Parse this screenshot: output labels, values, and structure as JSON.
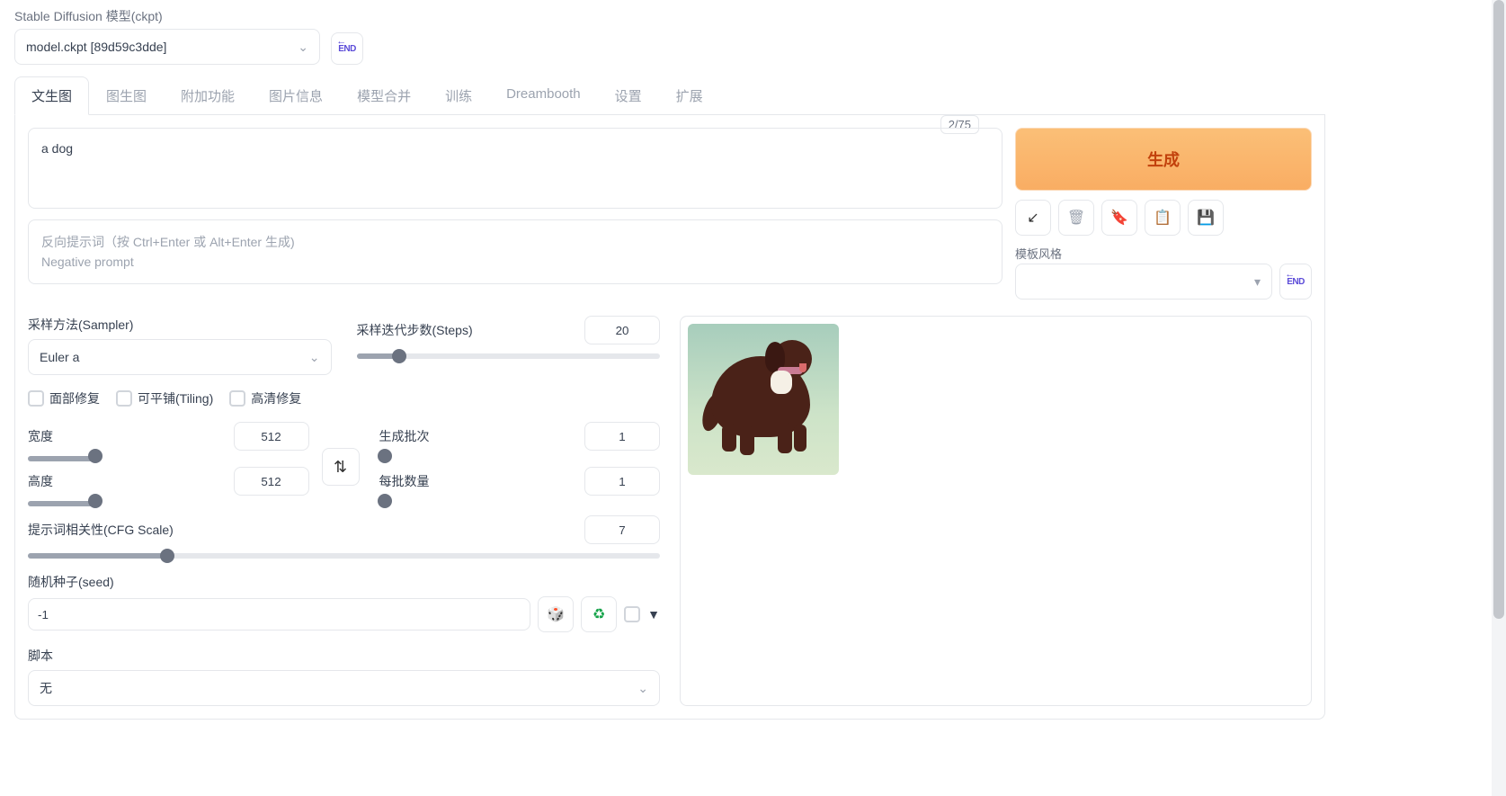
{
  "header": {
    "ckpt_label": "Stable Diffusion 模型(ckpt)",
    "ckpt_value": "model.ckpt [89d59c3dde]"
  },
  "tabs": [
    "文生图",
    "图生图",
    "附加功能",
    "图片信息",
    "模型合并",
    "训练",
    "Dreambooth",
    "设置",
    "扩展"
  ],
  "active_tab": 0,
  "token_counter": "2/75",
  "prompt": {
    "value": "a dog"
  },
  "neg_prompt": {
    "ph1": "反向提示词（按 Ctrl+Enter 或 Alt+Enter 生成)",
    "ph2": "Negative prompt"
  },
  "generate_label": "生成",
  "style": {
    "label": "模板风格"
  },
  "sampler": {
    "label": "采样方法(Sampler)",
    "value": "Euler a"
  },
  "steps": {
    "label": "采样迭代步数(Steps)",
    "value": "20",
    "pct": 14
  },
  "checks": {
    "face": "面部修复",
    "tiling": "可平铺(Tiling)",
    "hires": "高清修复"
  },
  "width": {
    "label": "宽度",
    "value": "512",
    "pct": 24
  },
  "height": {
    "label": "高度",
    "value": "512",
    "pct": 24
  },
  "batch_count": {
    "label": "生成批次",
    "value": "1",
    "pct": 2
  },
  "batch_size": {
    "label": "每批数量",
    "value": "1",
    "pct": 2
  },
  "cfg": {
    "label": "提示词相关性(CFG Scale)",
    "value": "7",
    "pct": 22
  },
  "seed": {
    "label": "随机种子(seed)",
    "value": "-1"
  },
  "script": {
    "label": "脚本",
    "value": "无"
  },
  "icons": {
    "refresh_end": "END",
    "arrow_in": "↙",
    "trash": "🗑",
    "bookmark": "🔖",
    "clipboard": "📋",
    "save": "💾",
    "swap": "⇅",
    "dice": "🎲",
    "recycle": "♻",
    "tri_down": "▼",
    "chev_down": "⌄",
    "small_tri": "▾"
  }
}
